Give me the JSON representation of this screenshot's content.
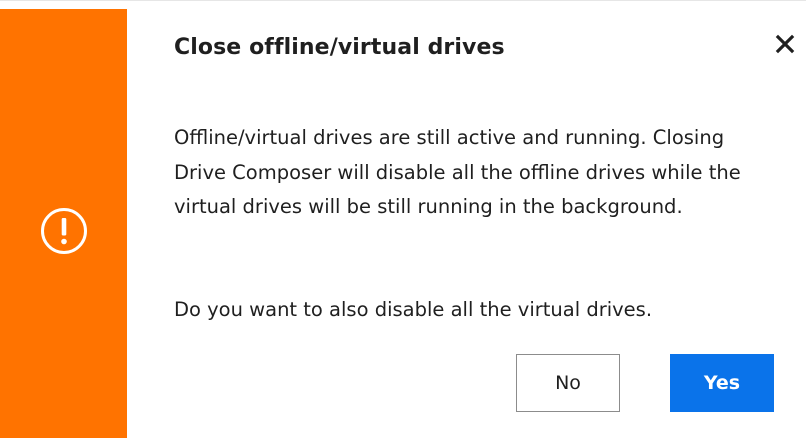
{
  "dialog": {
    "title": "Close offline/virtual drives",
    "message": "Offline/virtual drives are still active and running. Closing Drive Composer will disable all the offline drives while the virtual drives will be still running in the background.",
    "question": "Do you want to also disable all the virtual drives.",
    "buttons": {
      "no_label": "No",
      "yes_label": "Yes"
    },
    "icons": {
      "status": "warning-exclamation-icon",
      "close": "close-icon"
    }
  },
  "colors": {
    "accent": "#ff7300",
    "primary_button": "#0a73ea",
    "text": "#1f1f1f"
  }
}
